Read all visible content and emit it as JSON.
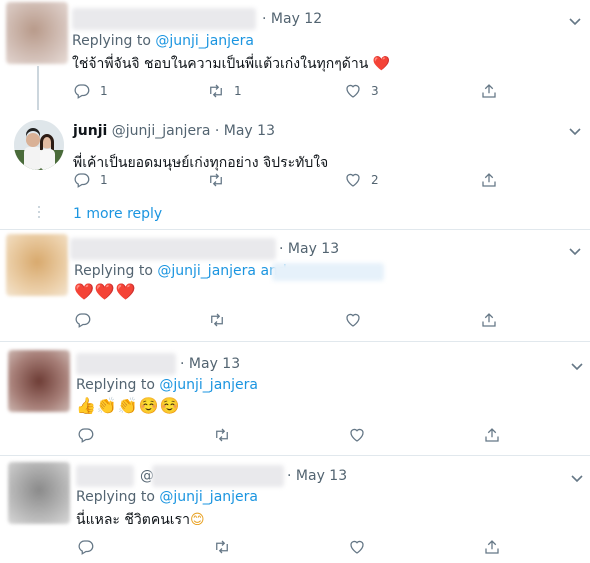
{
  "colors": {
    "link": "#1b95e0",
    "heart": "#e0245e",
    "muted": "#536471",
    "divider": "#e1e8ed"
  },
  "icons": {
    "reply": "reply-icon",
    "retweet": "retweet-icon",
    "like": "heart-icon",
    "share": "share-icon",
    "menu": "chevron-down-icon"
  },
  "tweets": [
    {
      "date": "May 12",
      "replying_prefix": "Replying to",
      "replying_to": "@junji_janjera",
      "text": "ใช่จ้าพี่จันจิ ชอบในความเป็นพี่แต้วเก่งในทุกๆด้าน",
      "emoji": "❤️",
      "replies": "1",
      "retweets": "1",
      "likes": "3"
    },
    {
      "name": "junji",
      "handle": "@junji_janjera",
      "date": "May 13",
      "text": "พี่เค้าเป็นยอดมนุษย์เก่งทุกอย่าง จิประทับใจ",
      "replies": "1",
      "retweets": "",
      "likes": "2"
    },
    {
      "date": "May 13",
      "replying_prefix": "Replying to",
      "replying_to": "@junji_janjera",
      "replying_and": "and",
      "text": "❤️❤️❤️"
    },
    {
      "date": "May 13",
      "replying_prefix": "Replying to",
      "replying_to": "@junji_janjera",
      "text": "👍👏👏☺️☺️"
    },
    {
      "at_sign": "@",
      "date": "May 13",
      "replying_prefix": "Replying to",
      "replying_to": "@junji_janjera",
      "text": "นี่แหละ ชีวิตคนเรา",
      "emoji": "😊"
    }
  ],
  "more_reply": "1 more reply"
}
